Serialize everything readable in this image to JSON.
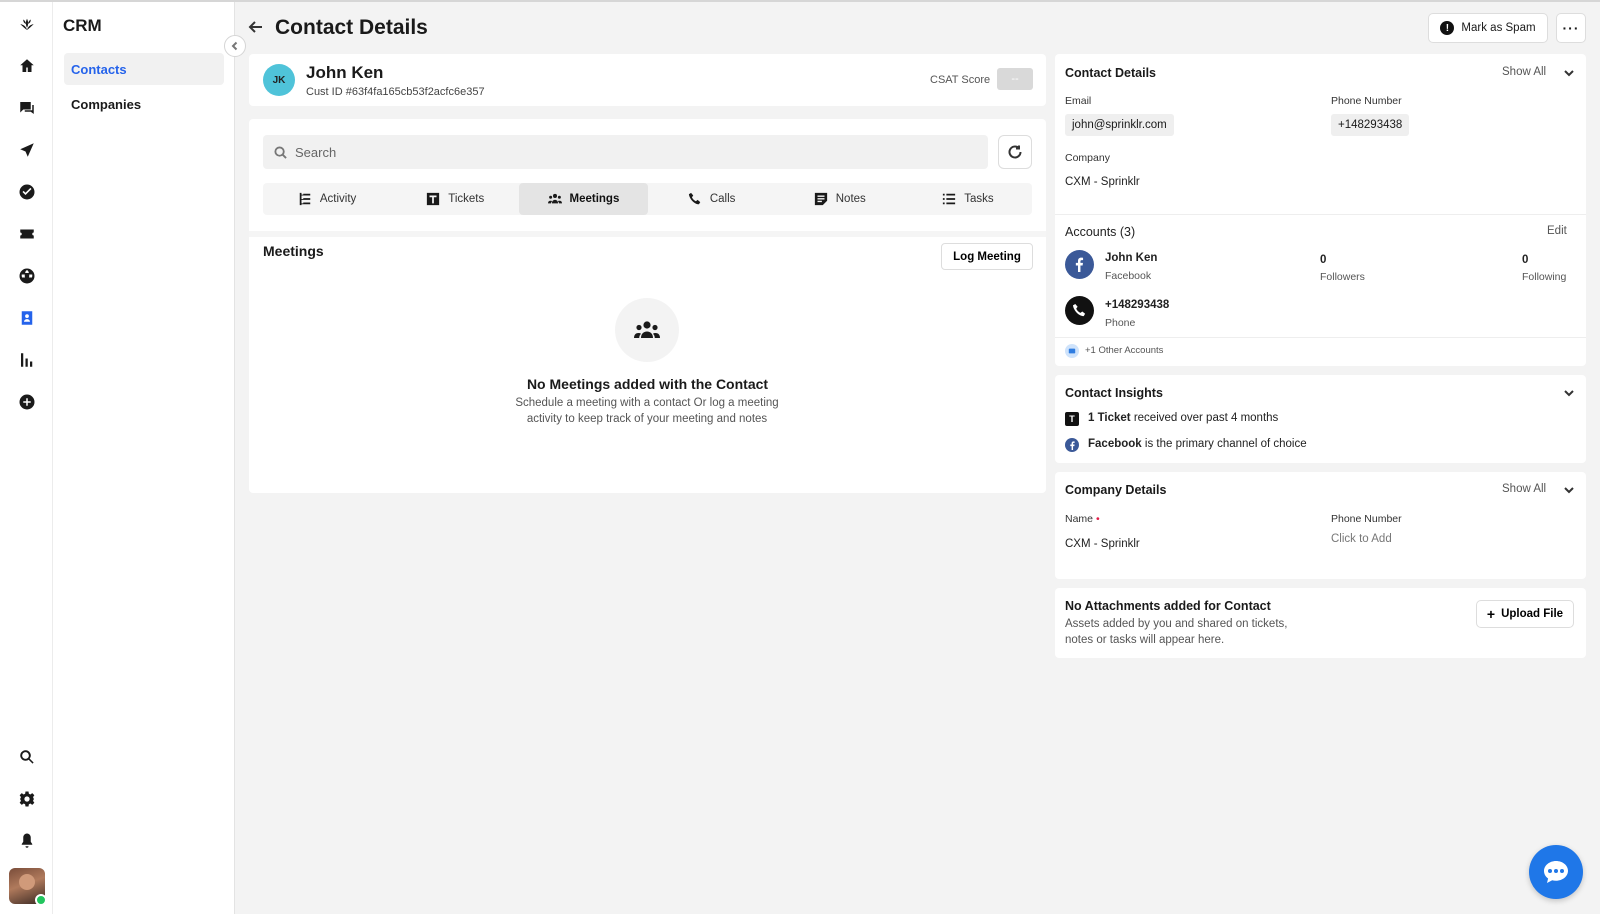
{
  "app": {
    "name": "CRM"
  },
  "rail": {
    "icons": [
      "logo-icon",
      "home-icon",
      "chat-icon",
      "send-icon",
      "check-circle-icon",
      "ticket-icon",
      "globe-icon",
      "contacts-icon",
      "bar-chart-icon",
      "add-circle-icon",
      "search-icon",
      "gear-icon",
      "bell-icon"
    ]
  },
  "subnav": {
    "title": "CRM",
    "items": [
      {
        "label": "Contacts",
        "active": true
      },
      {
        "label": "Companies",
        "active": false
      }
    ]
  },
  "header": {
    "title": "Contact Details",
    "spam_label": "Mark as Spam",
    "more_label": "···"
  },
  "contact": {
    "initials": "JK",
    "name": "John Ken",
    "cust_id": "Cust ID #63f4fa165cb53f2acfc6e357",
    "csat_label": "CSAT Score",
    "csat_value": "--"
  },
  "main": {
    "search_placeholder": "Search",
    "tabs": [
      {
        "label": "Activity",
        "icon": "activity-icon"
      },
      {
        "label": "Tickets",
        "icon": "ticket-t-icon"
      },
      {
        "label": "Meetings",
        "icon": "people-icon",
        "active": true
      },
      {
        "label": "Calls",
        "icon": "phone-icon"
      },
      {
        "label": "Notes",
        "icon": "notes-icon"
      },
      {
        "label": "Tasks",
        "icon": "list-icon"
      }
    ],
    "section_title": "Meetings",
    "log_button": "Log Meeting",
    "empty_title": "No Meetings added with the Contact",
    "empty_desc": "Schedule a meeting with a contact Or log a meeting activity to keep track of your meeting and notes"
  },
  "contact_details": {
    "title": "Contact Details",
    "show_all": "Show All",
    "email_label": "Email",
    "email_value": "john@sprinklr.com",
    "phone_label": "Phone Number",
    "phone_value": "+148293438",
    "company_label": "Company",
    "company_value": "CXM - Sprinklr"
  },
  "accounts": {
    "title": "Accounts (3)",
    "edit_label": "Edit",
    "list": [
      {
        "name": "John Ken",
        "channel": "Facebook",
        "followers": "0",
        "followers_label": "Followers",
        "following": "0",
        "following_label": "Following"
      },
      {
        "name": "+148293438",
        "channel": "Phone"
      }
    ],
    "other": "+1 Other Accounts"
  },
  "insights": {
    "title": "Contact Insights",
    "line1_bold": "1 Ticket",
    "line1_rest": " received over past 4 months",
    "line2_bold": "Facebook",
    "line2_rest": " is the primary channel of choice"
  },
  "company_details": {
    "title": "Company Details",
    "show_all": "Show All",
    "name_label": "Name",
    "required_mark": "•",
    "name_value": "CXM - Sprinklr",
    "phone_label": "Phone Number",
    "phone_value": "Click to Add"
  },
  "attachments": {
    "title": "No Attachments added for Contact",
    "desc": "Assets added by you and shared on tickets, notes or tasks will appear here.",
    "upload_label": "Upload File"
  },
  "colors": {
    "accent": "#2563eb",
    "facebook": "#3b5998",
    "fab": "#1f77e8",
    "online": "#22c55e",
    "required": "#e11d48"
  }
}
